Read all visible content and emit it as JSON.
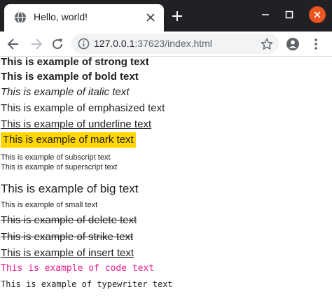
{
  "colors": {
    "title_bar": "#202124",
    "close_button": "#e95420",
    "mark_highlight": "#ffd600",
    "code_text": "#e91e8c",
    "body_text": "#202124",
    "omnibox_bg": "#f1f3f4"
  },
  "tab": {
    "title": "Hello, world!",
    "favicon": "globe-icon",
    "close_icon": "close-icon"
  },
  "window_controls": {
    "icons": [
      "minimize-icon",
      "maximize-icon",
      "close-icon"
    ]
  },
  "toolbar": {
    "icons": [
      "back-arrow-icon",
      "forward-arrow-icon",
      "reload-icon",
      "info-icon",
      "star-icon",
      "account-icon",
      "kebab-menu-icon"
    ],
    "url_host": "127.0.0.1",
    "url_rest": ":37623/index.html"
  },
  "content": {
    "strong": "This is example of strong text",
    "bold": "This is example of bold text",
    "italic": "This is example of italic text",
    "emphasized": "This is example of emphasized text",
    "underline": "This is example of underline text",
    "mark": "This is example of mark text",
    "subscript": "This is example of subscript text",
    "superscript": "This is example of superscript text",
    "big": "This is example of big text",
    "small": "This is example of small text",
    "delete": "This is example of delete text",
    "strike": "This is example of strike text",
    "insert": "This is example of insert text",
    "code": "This is example of code text",
    "typewriter": "This is example of typewriter text"
  }
}
